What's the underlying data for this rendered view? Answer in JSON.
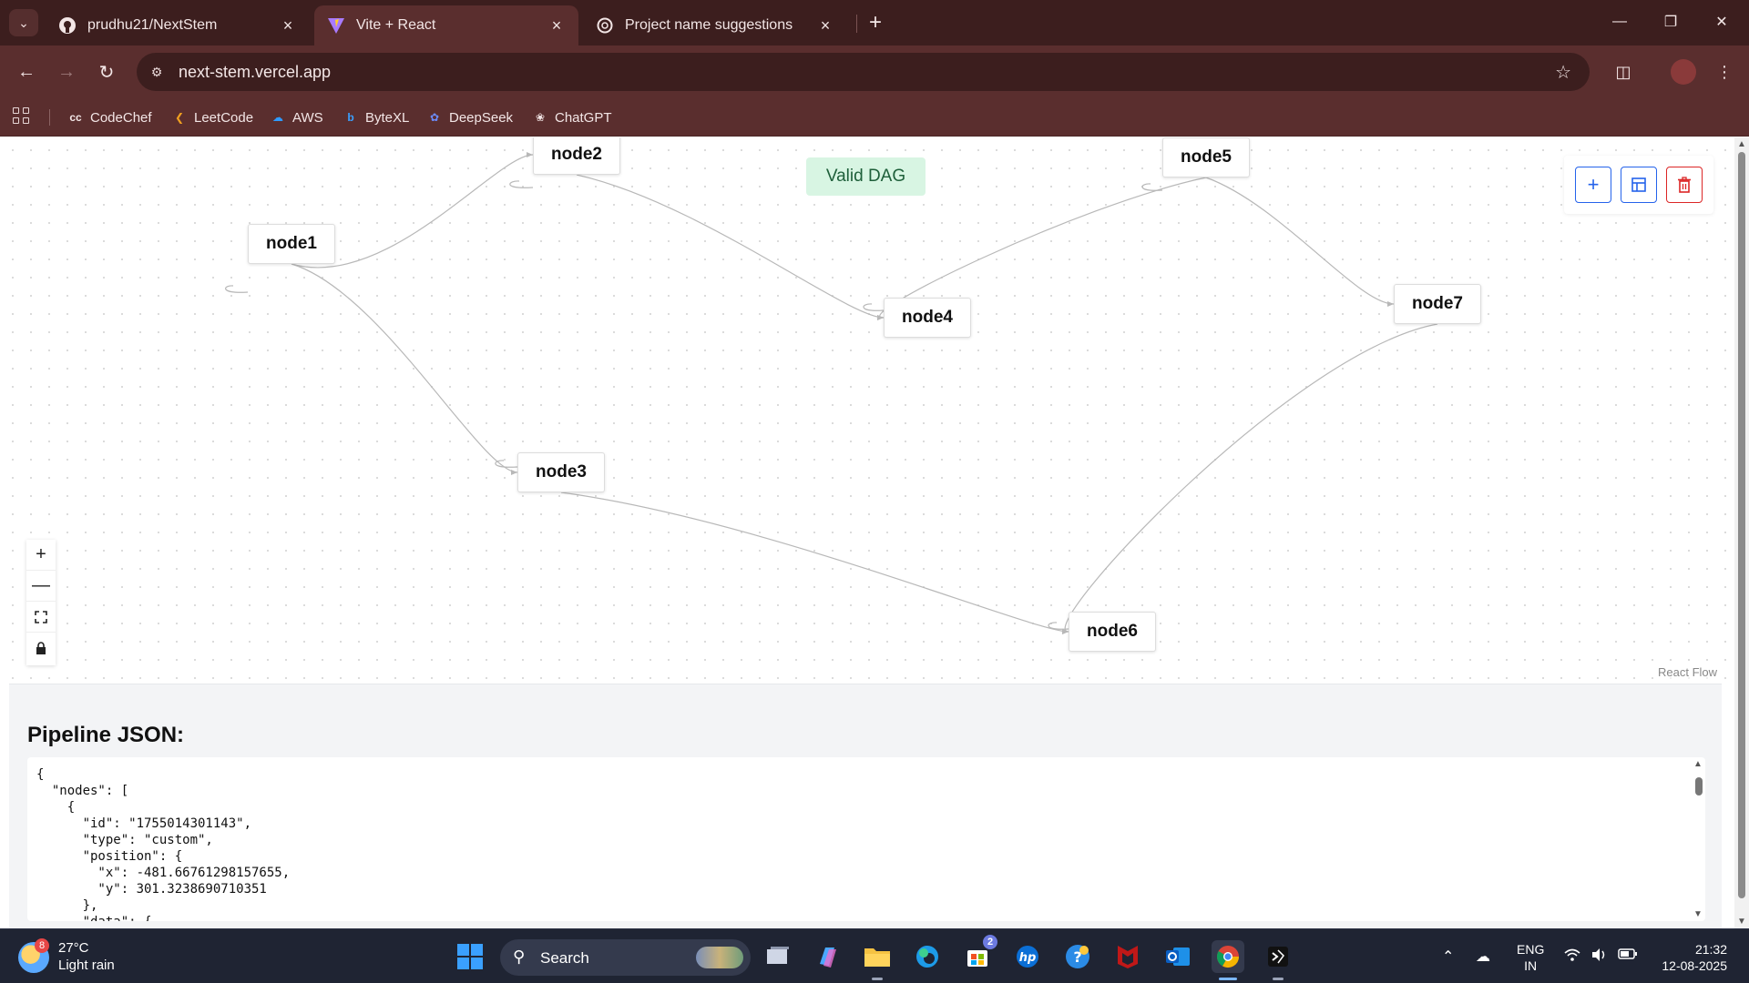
{
  "browser": {
    "tabs": [
      {
        "title": "prudhu21/NextStem",
        "icon": "github-icon",
        "active": false
      },
      {
        "title": "Vite + React",
        "icon": "vite-icon",
        "active": true
      },
      {
        "title": "Project name suggestions",
        "icon": "chatgpt-icon",
        "active": false
      }
    ],
    "url": "next-stem.vercel.app",
    "bookmarks": [
      {
        "label": "CodeChef",
        "icon": "codechef-icon"
      },
      {
        "label": "LeetCode",
        "icon": "leetcode-icon"
      },
      {
        "label": "AWS",
        "icon": "aws-icon"
      },
      {
        "label": "ByteXL",
        "icon": "bytexl-icon"
      },
      {
        "label": "DeepSeek",
        "icon": "deepseek-icon"
      },
      {
        "label": "ChatGPT",
        "icon": "chatgpt-icon"
      }
    ]
  },
  "canvas": {
    "status": "Valid DAG",
    "nodes": [
      {
        "id": "node1",
        "label": "node1"
      },
      {
        "id": "node2",
        "label": "node2"
      },
      {
        "id": "node3",
        "label": "node3"
      },
      {
        "id": "node4",
        "label": "node4"
      },
      {
        "id": "node5",
        "label": "node5"
      },
      {
        "id": "node6",
        "label": "node6"
      },
      {
        "id": "node7",
        "label": "node7"
      }
    ],
    "edges": [
      {
        "source": "node1",
        "target": "node2"
      },
      {
        "source": "node1",
        "target": "node3"
      },
      {
        "source": "node2",
        "target": "node4"
      },
      {
        "source": "node5",
        "target": "node4"
      },
      {
        "source": "node5",
        "target": "node7"
      },
      {
        "source": "node3",
        "target": "node6"
      },
      {
        "source": "node7",
        "target": "node6"
      }
    ],
    "actions": [
      {
        "name": "add-node",
        "icon": "plus-icon",
        "color": "#2563eb"
      },
      {
        "name": "auto-layout",
        "icon": "layout-icon",
        "color": "#2563eb"
      },
      {
        "name": "delete",
        "icon": "trash-icon",
        "color": "#dc2626"
      }
    ],
    "zoom_controls": [
      "zoom-in",
      "zoom-out",
      "fit-view",
      "lock"
    ],
    "attribution": "React Flow"
  },
  "json_panel": {
    "heading": "Pipeline JSON:",
    "content": "{\n  \"nodes\": [\n    {\n      \"id\": \"1755014301143\",\n      \"type\": \"custom\",\n      \"position\": {\n        \"x\": -481.66761298157655,\n        \"y\": 301.3238690710351\n      },\n      \"data\": {"
  },
  "taskbar": {
    "weather": {
      "temp": "27°C",
      "condition": "Light rain",
      "badge": "8"
    },
    "search_label": "Search",
    "store_badge": "2",
    "language": [
      "ENG",
      "IN"
    ],
    "time": "21:32",
    "date": "12-08-2025"
  },
  "colors": {
    "chrome_dark": "#3c1e1e",
    "chrome": "#5a2e2e",
    "valid_badge_bg": "#d8f5e3",
    "valid_badge_text": "#1e5f3a",
    "edge": "#b8b8b8"
  }
}
